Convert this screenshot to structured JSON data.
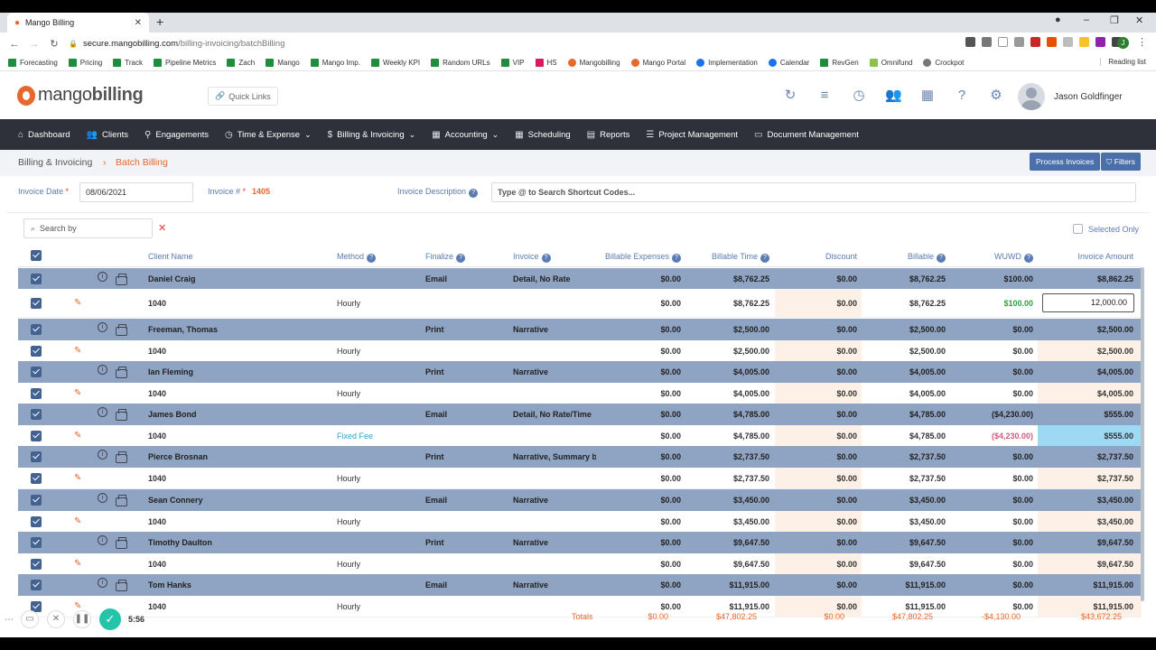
{
  "browser": {
    "tab_title": "Mango Billing",
    "url_host": "secure.mangobilling.com",
    "url_path": "/billing-invoicing/batchBilling",
    "profile_initial": "J",
    "bookmarks": [
      "Forecasting",
      "Pricing",
      "Track",
      "Pipeline Metrics",
      "Zach",
      "Mango",
      "Mango Imp.",
      "Weekly KPI",
      "Random URLs",
      "VIP",
      "HS",
      "Mangobilling",
      "Mango Portal",
      "Implementation",
      "Calendar",
      "RevGen",
      "Omnifund",
      "Crockpot"
    ],
    "reading_list": "Reading list"
  },
  "app": {
    "logo_light": "mango",
    "logo_bold": "billing",
    "quick_links": "Quick Links",
    "user_name": "Jason Goldfinger"
  },
  "nav": {
    "items": [
      "Dashboard",
      "Clients",
      "Engagements",
      "Time & Expense",
      "Billing & Invoicing",
      "Accounting",
      "Scheduling",
      "Reports",
      "Project Management",
      "Document Management"
    ]
  },
  "breadcrumb": {
    "parent": "Billing & Invoicing",
    "separator": "›",
    "current": "Batch Billing"
  },
  "actions": {
    "process": "Process Invoices",
    "filters": "Filters"
  },
  "invoice": {
    "date_label": "Invoice Date",
    "date_value": "08/06/2021",
    "number_label": "Invoice #",
    "number_value": "1405",
    "desc_label": "Invoice Description",
    "desc_placeholder": "Type @ to Search Shortcut Codes..."
  },
  "table": {
    "search_placeholder": "Search by",
    "selected_only": "Selected Only",
    "headers": {
      "client": "Client Name",
      "method": "Method",
      "finalize": "Finalize",
      "invoice": "Invoice",
      "expenses": "Billable Expenses",
      "time": "Billable Time",
      "discount": "Discount",
      "billable": "Billable",
      "wuwd": "WUWD",
      "amount": "Invoice Amount"
    },
    "clients": [
      {
        "name": "Daniel Craig",
        "finalize": "Email",
        "invoice": "Detail, No Rate",
        "expenses": "$0.00",
        "time": "$8,762.25",
        "discount": "$0.00",
        "billable": "$8,762.25",
        "wuwd": "$100.00",
        "amount": "$8,862.25",
        "detail": {
          "code": "1040",
          "method": "Hourly",
          "expenses": "$0.00",
          "time": "$8,762.25",
          "discount": "$0.00",
          "billable": "$8,762.25",
          "wuwd": "$100.00",
          "amount": "12,000.00"
        }
      },
      {
        "name": "Freeman, Thomas",
        "finalize": "Print",
        "invoice": "Narrative",
        "expenses": "$0.00",
        "time": "$2,500.00",
        "discount": "$0.00",
        "billable": "$2,500.00",
        "wuwd": "$0.00",
        "amount": "$2,500.00",
        "detail": {
          "code": "1040",
          "method": "Hourly",
          "expenses": "$0.00",
          "time": "$2,500.00",
          "discount": "$0.00",
          "billable": "$2,500.00",
          "wuwd": "$0.00",
          "amount": "$2,500.00"
        }
      },
      {
        "name": "Ian Fleming",
        "finalize": "Print",
        "invoice": "Narrative",
        "expenses": "$0.00",
        "time": "$4,005.00",
        "discount": "$0.00",
        "billable": "$4,005.00",
        "wuwd": "$0.00",
        "amount": "$4,005.00",
        "detail": {
          "code": "1040",
          "method": "Hourly",
          "expenses": "$0.00",
          "time": "$4,005.00",
          "discount": "$0.00",
          "billable": "$4,005.00",
          "wuwd": "$0.00",
          "amount": "$4,005.00"
        }
      },
      {
        "name": "James Bond",
        "finalize": "Email",
        "invoice": "Detail, No Rate/Time",
        "expenses": "$0.00",
        "time": "$4,785.00",
        "discount": "$0.00",
        "billable": "$4,785.00",
        "wuwd": "($4,230.00)",
        "amount": "$555.00",
        "detail": {
          "code": "1040",
          "method": "Fixed Fee",
          "expenses": "$0.00",
          "time": "$4,785.00",
          "discount": "$0.00",
          "billable": "$4,785.00",
          "wuwd": "($4,230.00)",
          "amount": "$555.00"
        }
      },
      {
        "name": "Pierce Brosnan",
        "finalize": "Print",
        "invoice": "Narrative, Summary b",
        "expenses": "$0.00",
        "time": "$2,737.50",
        "discount": "$0.00",
        "billable": "$2,737.50",
        "wuwd": "$0.00",
        "amount": "$2,737.50",
        "detail": {
          "code": "1040",
          "method": "Hourly",
          "expenses": "$0.00",
          "time": "$2,737.50",
          "discount": "$0.00",
          "billable": "$2,737.50",
          "wuwd": "$0.00",
          "amount": "$2,737.50"
        }
      },
      {
        "name": "Sean Connery",
        "finalize": "Email",
        "invoice": "Narrative",
        "expenses": "$0.00",
        "time": "$3,450.00",
        "discount": "$0.00",
        "billable": "$3,450.00",
        "wuwd": "$0.00",
        "amount": "$3,450.00",
        "detail": {
          "code": "1040",
          "method": "Hourly",
          "expenses": "$0.00",
          "time": "$3,450.00",
          "discount": "$0.00",
          "billable": "$3,450.00",
          "wuwd": "$0.00",
          "amount": "$3,450.00"
        }
      },
      {
        "name": "Timothy Daulton",
        "finalize": "Print",
        "invoice": "Narrative",
        "expenses": "$0.00",
        "time": "$9,647.50",
        "discount": "$0.00",
        "billable": "$9,647.50",
        "wuwd": "$0.00",
        "amount": "$9,647.50",
        "detail": {
          "code": "1040",
          "method": "Hourly",
          "expenses": "$0.00",
          "time": "$9,647.50",
          "discount": "$0.00",
          "billable": "$9,647.50",
          "wuwd": "$0.00",
          "amount": "$9,647.50"
        }
      },
      {
        "name": "Tom Hanks",
        "finalize": "Email",
        "invoice": "Narrative",
        "expenses": "$0.00",
        "time": "$11,915.00",
        "discount": "$0.00",
        "billable": "$11,915.00",
        "wuwd": "$0.00",
        "amount": "$11,915.00",
        "detail": {
          "code": "1040",
          "method": "Hourly",
          "expenses": "$0.00",
          "time": "$11,915.00",
          "discount": "$0.00",
          "billable": "$11,915.00",
          "wuwd": "$0.00",
          "amount": "$11,915.00"
        }
      }
    ],
    "totals": {
      "label": "Totals",
      "expenses": "$0.00",
      "time": "$47,802.25",
      "discount": "$0.00",
      "billable": "$47,802.25",
      "wuwd": "-$4,130.00",
      "amount": "$43,672.25"
    }
  },
  "recorder": {
    "time": "5:56"
  },
  "colors": {
    "accent": "#e8672c",
    "nav_bg": "#2e3139",
    "client_row": "#8fa3c2",
    "link_blue": "#5b7bb2"
  }
}
